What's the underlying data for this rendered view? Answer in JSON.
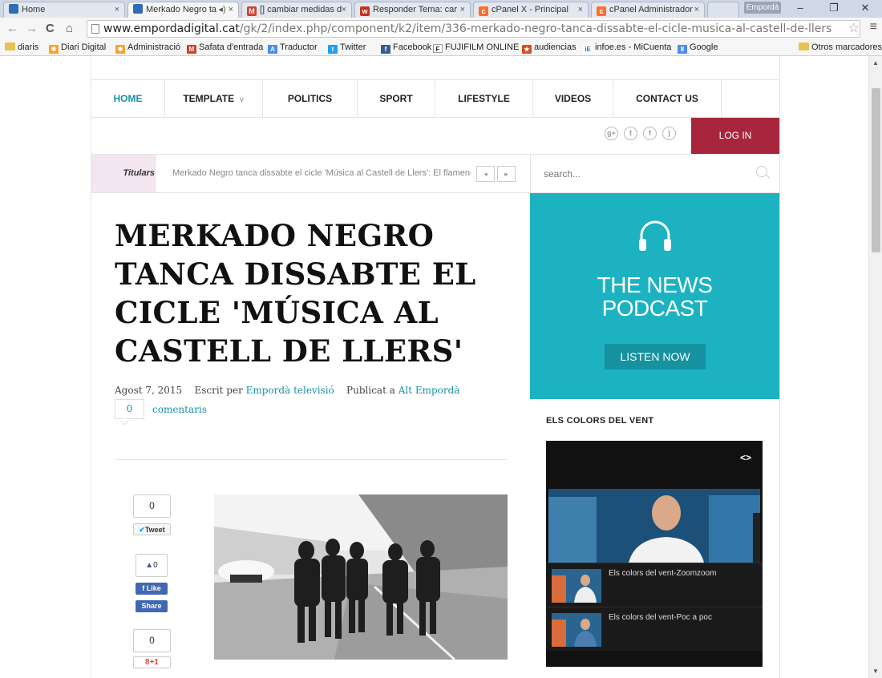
{
  "browser": {
    "tabs": [
      {
        "label": "Home",
        "icon_color": "#2f6db5"
      },
      {
        "label": "Merkado Negro ta",
        "icon_color": "#2f6db5"
      },
      {
        "label": "[] cambiar medidas d",
        "icon_color": "#d23f31"
      },
      {
        "label": "Responder Tema: car",
        "icon_color": "#c5301f"
      },
      {
        "label": "cPanel X - Principal",
        "icon_color": "#ff6c2c"
      },
      {
        "label": "cPanel Administrador",
        "icon_color": "#ff6c2c"
      }
    ],
    "profile": "Empordà",
    "url_host": "www.empordadigital.cat",
    "url_path": "/gk/2/index.php/component/k2/item/336-merkado-negro-tanca-dissabte-el-cicle-musica-al-castell-de-llers",
    "bookmarks": [
      {
        "label": "diaris",
        "icon": "folder-icon"
      },
      {
        "label": "Diari Digital",
        "icon": "joomla-icon"
      },
      {
        "label": "Administració",
        "icon": "joomla-icon"
      },
      {
        "label": "Safata d'entrada",
        "icon": "gmail-icon"
      },
      {
        "label": "Traductor",
        "icon": "translate-icon"
      },
      {
        "label": "Twitter",
        "icon": "twitter-icon"
      },
      {
        "label": "Facebook",
        "icon": "facebook-icon"
      },
      {
        "label": "FUJIFILM ONLINE",
        "icon": "fujifilm-icon"
      },
      {
        "label": "audiencias",
        "icon": "star-icon"
      },
      {
        "label": "infoe.es - MiCuenta",
        "icon": "infoe-icon"
      },
      {
        "label": "Google",
        "icon": "google-icon"
      },
      {
        "label": "Otros marcadores",
        "icon": "folder-icon"
      }
    ]
  },
  "nav": {
    "items": [
      "HOME",
      "TEMPLATE",
      "POLITICS",
      "SPORT",
      "LIFESTYLE",
      "VIDEOS",
      "CONTACT US"
    ],
    "login": "LOG IN",
    "accent": "#1a8fa5"
  },
  "ticker": {
    "label": "Titulars",
    "text": "Merkado Negro tanca dissabte el cicle 'Música al Castell de Llers':  El flamenc-"
  },
  "search": {
    "placeholder": "search..."
  },
  "article": {
    "title": "MERKADO NEGRO TANCA DISSABTE EL CICLE 'MÚSICA AL CASTELL DE LLERS'",
    "date": "Agost 7, 2015",
    "written_by_label": "Escrit per",
    "author": "Empordà televisió",
    "published_label": "Publicat a",
    "category": "Alt Empordà",
    "comment_count": "0",
    "comments_label": "comentaris"
  },
  "share": {
    "tweet_count": "0",
    "tweet_label": "Tweet",
    "like_count": "0",
    "like_label": "Like",
    "share_label": "Share",
    "gplus_count": "0",
    "gplus_label": "8+1"
  },
  "sidebar": {
    "podcast_title_line1": "THE NEWS",
    "podcast_title_line2": "PODCAST",
    "listen_now": "LISTEN NOW",
    "colors_heading": "ELS COLORS DEL VENT",
    "playlist": [
      {
        "title": "Els colors del vent-Zoomzoom"
      },
      {
        "title": "Els colors del vent-Poc a poc"
      }
    ]
  }
}
